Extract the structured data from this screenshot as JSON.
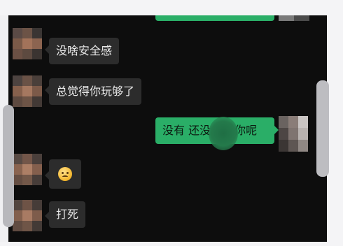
{
  "messages": [
    {
      "side": "in",
      "text": "没啥安全感"
    },
    {
      "side": "in",
      "text": "总觉得你玩够了"
    },
    {
      "side": "out",
      "text_before": "没有 还没",
      "text_after": "你呢"
    },
    {
      "side": "in",
      "emoji": "worried-face-emoji"
    },
    {
      "side": "in",
      "text": "打死"
    }
  ],
  "colors": {
    "chat_bg": "#0d0d0d",
    "incoming_bubble": "#2c2c2c",
    "outgoing_bubble": "#2aae67"
  }
}
